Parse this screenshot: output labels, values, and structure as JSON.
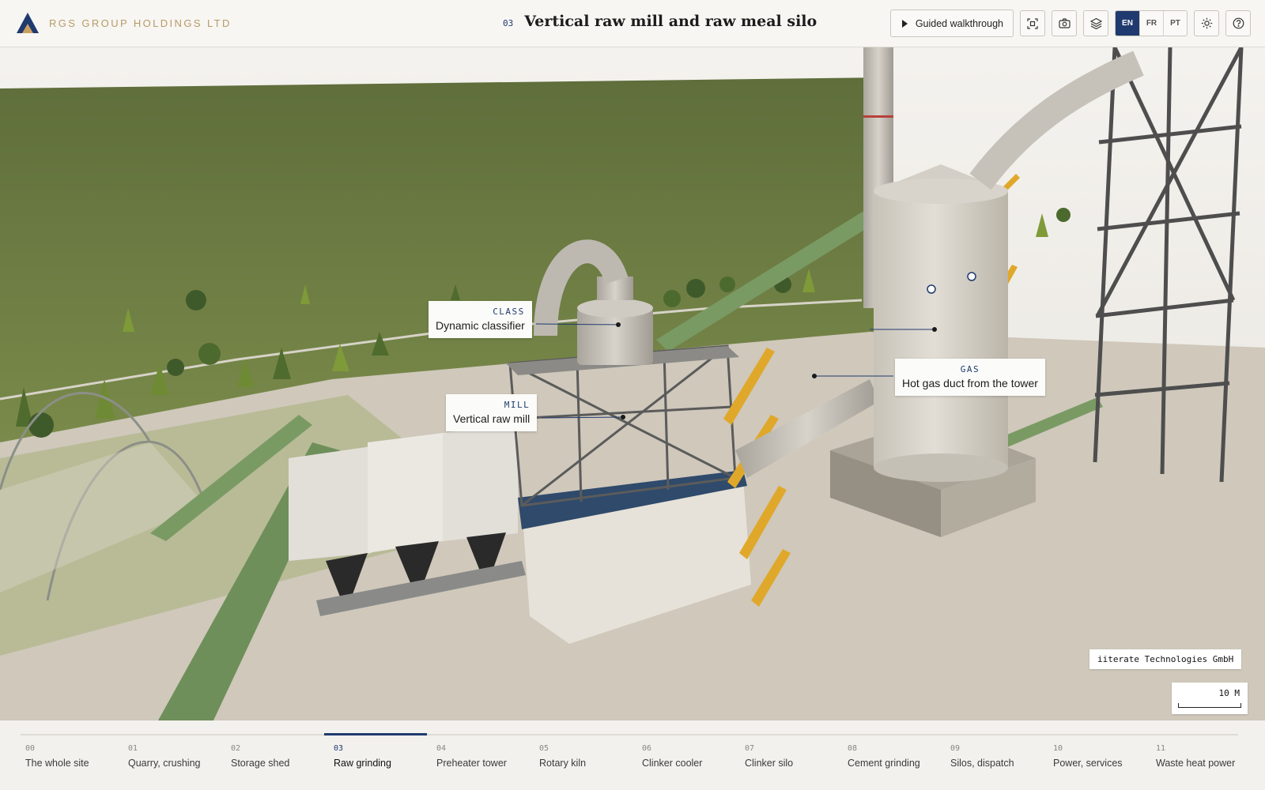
{
  "header": {
    "brand": "RGS GROUP HOLDINGS LTD",
    "section_number": "03",
    "title": "Vertical raw mill and raw meal silo",
    "walkthrough_label": "Guided walkthrough",
    "icons": [
      "focus-icon",
      "camera-icon",
      "layers-icon",
      "sun-icon",
      "help-icon"
    ],
    "languages": [
      "EN",
      "FR",
      "PT"
    ],
    "active_language": "EN"
  },
  "callouts": {
    "classifier": {
      "tag": "CLASS",
      "label": "Dynamic classifier"
    },
    "mill": {
      "tag": "MILL",
      "label": "Vertical raw mill"
    },
    "gas": {
      "tag": "GAS",
      "label": "Hot gas duct from the tower"
    }
  },
  "credit": "iiterate Technologies GmbH",
  "scale": "10 M",
  "nav": {
    "active_index": 3,
    "items": [
      {
        "num": "00",
        "label": "The whole site"
      },
      {
        "num": "01",
        "label": "Quarry, crushing"
      },
      {
        "num": "02",
        "label": "Storage shed"
      },
      {
        "num": "03",
        "label": "Raw grinding"
      },
      {
        "num": "04",
        "label": "Preheater tower"
      },
      {
        "num": "05",
        "label": "Rotary kiln"
      },
      {
        "num": "06",
        "label": "Clinker cooler"
      },
      {
        "num": "07",
        "label": "Clinker silo"
      },
      {
        "num": "08",
        "label": "Cement grinding"
      },
      {
        "num": "09",
        "label": "Silos, dispatch"
      },
      {
        "num": "10",
        "label": "Power, services"
      },
      {
        "num": "11",
        "label": "Waste heat power"
      }
    ]
  },
  "colors": {
    "accent": "#1f3a6e",
    "brand": "#b89a66",
    "grass": "#6b7f3e",
    "ground": "#c9c2b5"
  }
}
